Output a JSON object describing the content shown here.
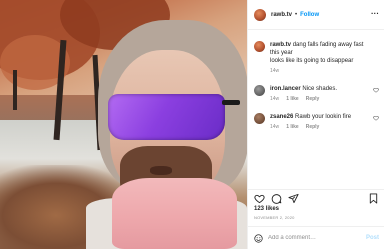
{
  "header": {
    "username": "rawb.tv",
    "separator": "•",
    "follow_label": "Follow",
    "more_label": "···"
  },
  "caption": {
    "username": "rawb.tv",
    "line1": "dang falls fading away fast",
    "line2": "this year",
    "line3": "looks like its going to disappear",
    "age": "14w"
  },
  "comments": [
    {
      "username": "iron.lancer",
      "text": "Nice shades.",
      "age": "14w",
      "likes": "1 like",
      "reply": "Reply"
    },
    {
      "username": "zsane26",
      "text": "Rawb your lookin fire",
      "age": "14w",
      "likes": "1 like",
      "reply": "Reply"
    }
  ],
  "stats": {
    "likes": "123 likes",
    "date": "NOVEMBER 2, 2020"
  },
  "add_comment": {
    "placeholder": "Add a comment…",
    "post_label": "Post"
  },
  "icons": {
    "like": "heart-icon",
    "comment": "comment-icon",
    "share": "share-icon",
    "save": "bookmark-icon",
    "emoji": "emoji-icon",
    "options": "more-icon"
  },
  "colors": {
    "accent": "#0095f6",
    "post_disabled": "#b2dffc",
    "muted": "#8e8e8e"
  }
}
